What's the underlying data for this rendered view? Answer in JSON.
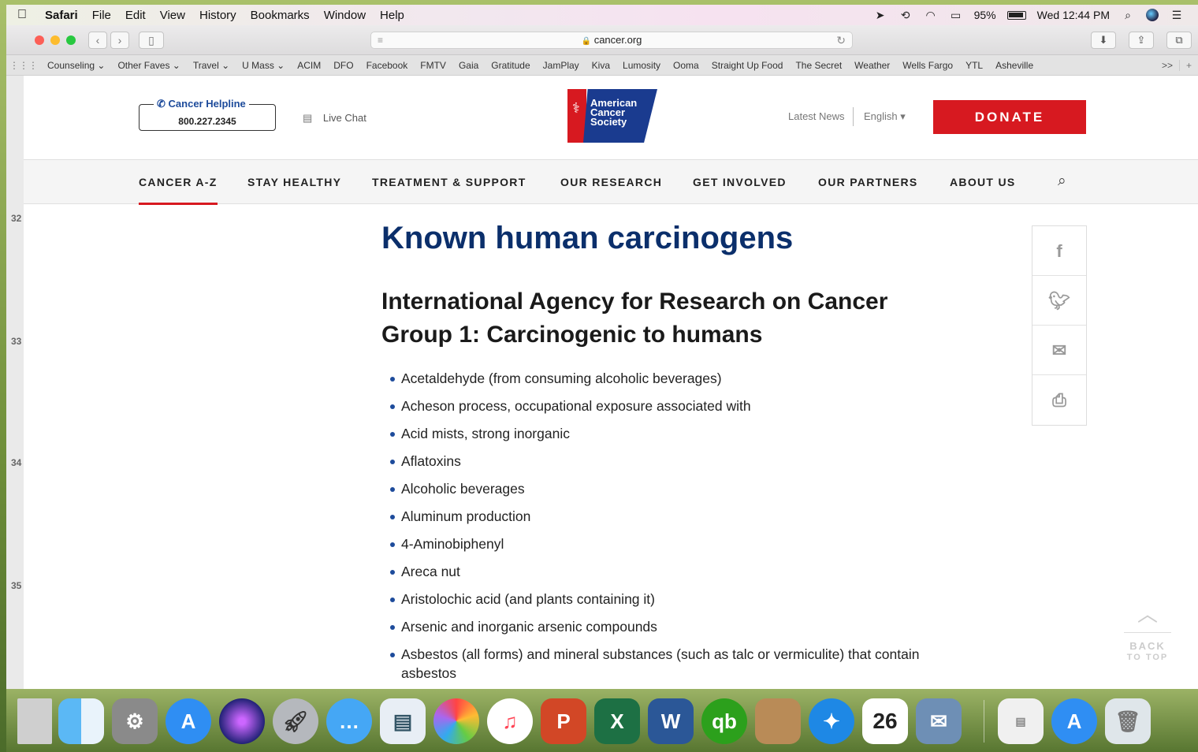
{
  "menubar": {
    "app": "Safari",
    "items": [
      "File",
      "Edit",
      "View",
      "History",
      "Bookmarks",
      "Window",
      "Help"
    ],
    "battery": "95%",
    "clock": "Wed 12:44 PM"
  },
  "browser": {
    "url": "cancer.org",
    "favorites": [
      "Counseling ⌄",
      "Other Faves ⌄",
      "Travel ⌄",
      "U Mass ⌄",
      "ACIM",
      "DFO",
      "Facebook",
      "FMTV",
      "Gaia",
      "Gratitude",
      "JamPlay",
      "Kiva",
      "Lumosity",
      "Ooma",
      "Straight Up Food",
      "The Secret",
      "Weather",
      "Wells Fargo",
      "YTL",
      "Asheville"
    ],
    "more": ">>",
    "gutter_numbers": [
      "32",
      "33",
      "34",
      "35"
    ]
  },
  "header": {
    "helpline_title": "Cancer Helpline",
    "helpline_phone": "800.227.2345",
    "live_chat": "Live Chat",
    "logo_lines": [
      "American",
      "Cancer",
      "Society"
    ],
    "latest_news": "Latest News",
    "language": "English ▾",
    "donate": "DONATE",
    "brand_red": "#d71920",
    "brand_blue": "#1a3b8f"
  },
  "nav": {
    "items": [
      "CANCER A-Z",
      "STAY HEALTHY",
      "TREATMENT & SUPPORT",
      "OUR RESEARCH",
      "GET INVOLVED",
      "OUR PARTNERS",
      "ABOUT US"
    ],
    "active": "CANCER A-Z"
  },
  "content": {
    "title": "Known human carcinogens",
    "subtitle": "International Agency for Research on Cancer Group 1: Carcinogenic to humans",
    "list": [
      "Acetaldehyde (from consuming alcoholic beverages)",
      "Acheson process, occupational exposure associated with",
      "Acid mists, strong inorganic",
      "Aflatoxins",
      "Alcoholic beverages",
      "Aluminum production",
      "4-Aminobiphenyl",
      "Areca nut",
      "Aristolochic acid (and plants containing it)",
      "Arsenic and inorganic arsenic compounds",
      "Asbestos (all forms) and mineral substances (such as talc or vermiculite) that contain asbestos"
    ]
  },
  "share": {
    "icons": [
      "facebook-icon",
      "twitter-icon",
      "email-icon",
      "print-icon"
    ]
  },
  "back_to_top": {
    "line1": "BACK",
    "line2": "TO TOP"
  },
  "dock": {
    "apps": [
      "Finder",
      "System Preferences",
      "App Store",
      "Siri",
      "Launchpad",
      "Messages",
      "Preview",
      "Photos",
      "iTunes",
      "PowerPoint",
      "Excel",
      "Word",
      "QuickBooks",
      "Contacts",
      "Safari",
      "Calendar",
      "Mail",
      "Documents",
      "App Store",
      "Trash"
    ],
    "calendar_day": "26",
    "calendar_month": "JUL"
  }
}
